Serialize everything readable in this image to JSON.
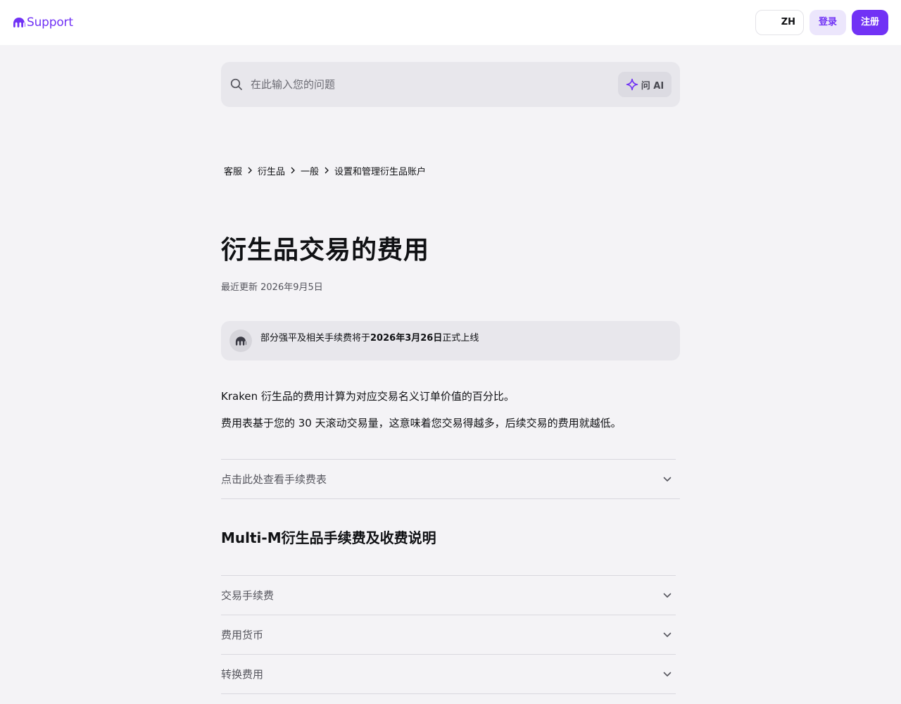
{
  "header": {
    "logo_text": "Support",
    "language": "ZH",
    "login_label": "登录",
    "signup_label": "注册",
    "brand_color": "#7132f5"
  },
  "search": {
    "placeholder": "在此输入您的问题",
    "ask_ai_label": "问 AI"
  },
  "breadcrumb": {
    "items": [
      "客服",
      "衍生品",
      "一般",
      "设置和管理衍生品账户"
    ]
  },
  "article": {
    "title": "衍生品交易的费用",
    "updated": "最近更新 2026年9月5日",
    "notice": {
      "prefix": "部分强平及相关手续费将于",
      "date": "2026年3月26日",
      "suffix": "正式上线"
    },
    "paragraphs": [
      "Kraken 衍生品的费用计算为对应交易名义订单价值的百分比。",
      "费用表基于您的 30 天滚动交易量，这意味着您交易得越多，后续交易的费用就越低。"
    ],
    "fee_table_accordion": "点击此处查看手续费表",
    "section_title": "Multi-M衍生品手续费及收费说明",
    "accordions": [
      "交易手续费",
      "费用货币",
      "转换费用"
    ]
  }
}
